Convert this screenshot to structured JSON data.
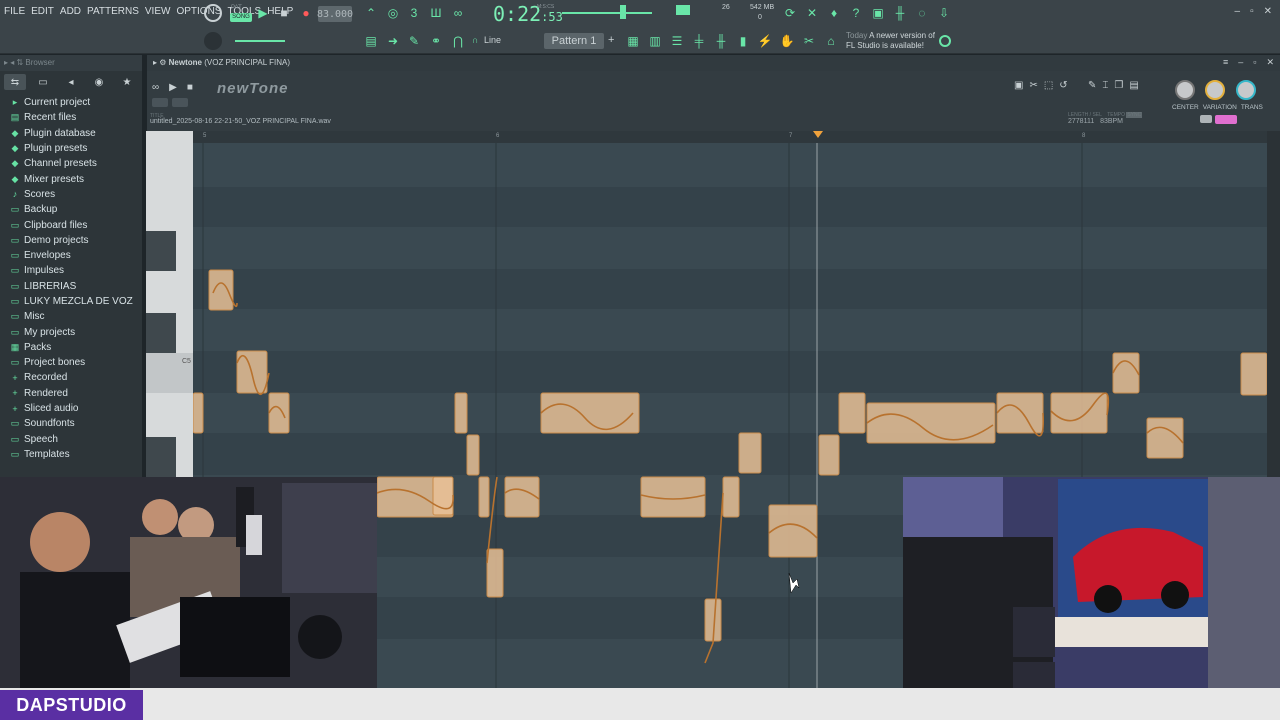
{
  "menu": [
    "FILE",
    "EDIT",
    "ADD",
    "PATTERNS",
    "VIEW",
    "OPTIONS",
    "TOOLS",
    "HELP"
  ],
  "transport": {
    "pat_label": "PAT",
    "song_label": "SONG",
    "tempo": "83.000",
    "time_main": "0:22",
    "time_sub": ":53",
    "time_label": "M:S:CS",
    "cpu": "26",
    "mem": "542 MB",
    "mem_sub": "0"
  },
  "toolbar": {
    "snap_label": "Line",
    "pattern_label": "Pattern 1"
  },
  "news": {
    "today": "Today",
    "line1": "A newer version of",
    "line2": "FL Studio is available!"
  },
  "browser": {
    "title": "Browser",
    "items": [
      {
        "icon": "▸",
        "label": "Current project"
      },
      {
        "icon": "▤",
        "label": "Recent files"
      },
      {
        "icon": "◆",
        "label": "Plugin database"
      },
      {
        "icon": "◆",
        "label": "Plugin presets"
      },
      {
        "icon": "◆",
        "label": "Channel presets"
      },
      {
        "icon": "◆",
        "label": "Mixer presets"
      },
      {
        "icon": "♪",
        "label": "Scores"
      },
      {
        "icon": "▭",
        "label": "Backup"
      },
      {
        "icon": "▭",
        "label": "Clipboard files"
      },
      {
        "icon": "▭",
        "label": "Demo projects"
      },
      {
        "icon": "▭",
        "label": "Envelopes"
      },
      {
        "icon": "▭",
        "label": "Impulses"
      },
      {
        "icon": "▭",
        "label": "LIBRERIAS"
      },
      {
        "icon": "▭",
        "label": "LUKY MEZCLA DE VOZ"
      },
      {
        "icon": "▭",
        "label": "Misc"
      },
      {
        "icon": "▭",
        "label": "My projects"
      },
      {
        "icon": "▦",
        "label": "Packs"
      },
      {
        "icon": "▭",
        "label": "Project bones"
      },
      {
        "icon": "+",
        "label": "Recorded"
      },
      {
        "icon": "+",
        "label": "Rendered"
      },
      {
        "icon": "+",
        "label": "Sliced audio"
      },
      {
        "icon": "▭",
        "label": "Soundfonts"
      },
      {
        "icon": "▭",
        "label": "Speech"
      },
      {
        "icon": "▭",
        "label": "Templates"
      }
    ]
  },
  "newtone": {
    "window_title": "Newtone",
    "window_sub": "(VOZ PRINCIPAL FINA)",
    "logo": "newTone",
    "title_label": "TITLE",
    "file": "untitled_2025-08-16 22-21-50_VOZ PRINCIPAL FINA.wav",
    "length_label": "LENGTH / SEL",
    "length": "2778111",
    "tempo_label": "TEMPO",
    "tempo": "83BPM",
    "sync": "SYNC",
    "knobs": [
      "CENTER",
      "VARIATION",
      "TRANS"
    ],
    "ruler_marks": [
      "5",
      "6",
      "7",
      "8"
    ],
    "note_label": "C5"
  },
  "brand": "DAPSTUDIO",
  "colors": {
    "accent": "#69e6a8",
    "note": "#e7c095",
    "brand": "#5a2fa3"
  }
}
